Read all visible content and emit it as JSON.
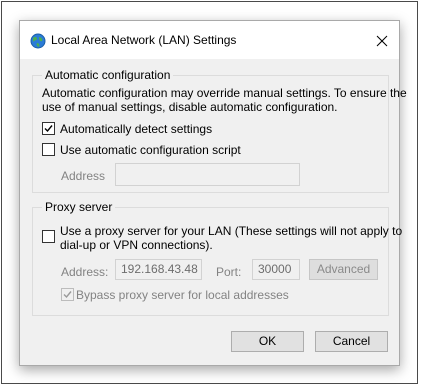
{
  "window": {
    "title": "Local Area Network (LAN) Settings",
    "icon": "globe-network-icon",
    "close_icon": "close-icon"
  },
  "automatic_configuration": {
    "group_label": "Automatic configuration",
    "description_line1": "Automatic configuration may override manual settings.  To ensure the",
    "description_line2": "use of manual settings, disable automatic configuration.",
    "detect_settings": {
      "label": "Automatically detect settings",
      "checked": true
    },
    "use_script": {
      "label": "Use automatic configuration script",
      "checked": false
    },
    "address_label": "Address",
    "address_value": ""
  },
  "proxy_server": {
    "group_label": "Proxy server",
    "use_proxy": {
      "label_line1": "Use a proxy server for your LAN (These settings will not apply to",
      "label_line2": "dial-up or VPN connections).",
      "checked": false
    },
    "address_label": "Address:",
    "address_value": "192.168.43.48",
    "port_label": "Port:",
    "port_value": "30000",
    "advanced_label": "Advanced",
    "bypass": {
      "label": "Bypass proxy server for local addresses",
      "checked": true,
      "enabled": false
    }
  },
  "buttons": {
    "ok": "OK",
    "cancel": "Cancel"
  },
  "colors": {
    "dialog_bg": "#f0f0f0",
    "titlebar_bg": "#ffffff",
    "globe_blue": "#2b7bd6",
    "globe_green": "#4caf50"
  }
}
